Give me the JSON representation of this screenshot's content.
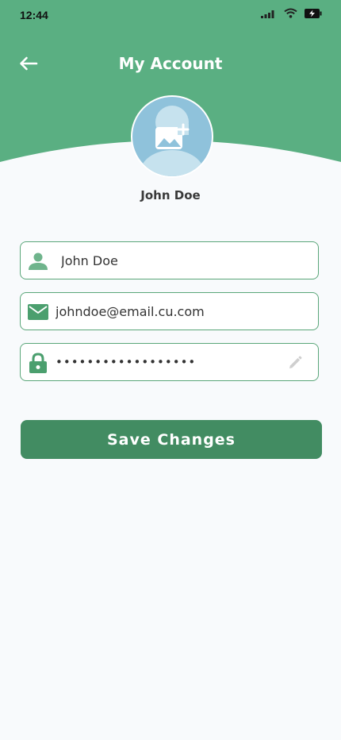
{
  "status_bar": {
    "time": "12:44",
    "icons": [
      "signal-icon",
      "wifi-icon",
      "battery-charging-icon"
    ]
  },
  "header": {
    "title": "My Account",
    "back_icon": "arrow-left-icon",
    "background_color": "#5aaf82"
  },
  "profile": {
    "name": "John Doe",
    "avatar_icon": "add-photo-icon"
  },
  "form": {
    "name_value": "John Doe",
    "email_value": "johndoe@email.cu.com",
    "password_value": "••••••••••••••••••",
    "name_icon": "person-icon",
    "email_icon": "mail-icon",
    "password_icon": "lock-icon",
    "edit_icon": "pencil-icon"
  },
  "actions": {
    "save_label": "Save Changes"
  },
  "colors": {
    "accent": "#5aaf82",
    "button": "#428c62",
    "field_border": "#5aa679"
  }
}
